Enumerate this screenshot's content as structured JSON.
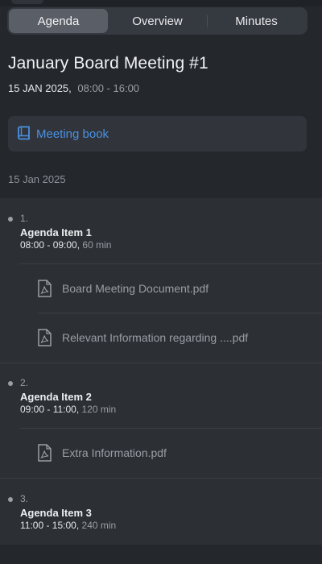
{
  "tabs": [
    {
      "label": "Agenda",
      "active": true
    },
    {
      "label": "Overview",
      "active": false
    },
    {
      "label": "Minutes",
      "active": false
    }
  ],
  "meeting": {
    "title": "January Board Meeting #1",
    "date": "15 JAN 2025,",
    "time": "08:00 - 16:00"
  },
  "meeting_book": {
    "label": "Meeting book",
    "icon": "book-icon",
    "color": "#4a90e2"
  },
  "section_date": "15 Jan 2025",
  "agenda": [
    {
      "number": "1.",
      "name": "Agenda Item 1",
      "time": "08:00 - 09:00,",
      "duration": "60 min",
      "documents": [
        {
          "name": "Board Meeting Document.pdf",
          "icon": "pdf-file-icon"
        },
        {
          "name": "Relevant Information regarding ....pdf",
          "icon": "pdf-file-icon"
        }
      ]
    },
    {
      "number": "2.",
      "name": "Agenda Item 2",
      "time": "09:00 - 11:00,",
      "duration": "120 min",
      "documents": [
        {
          "name": "Extra Information.pdf",
          "icon": "pdf-file-icon"
        }
      ]
    },
    {
      "number": "3.",
      "name": "Agenda Item 3",
      "time": "11:00 - 15:00,",
      "duration": "240 min",
      "documents": []
    }
  ]
}
